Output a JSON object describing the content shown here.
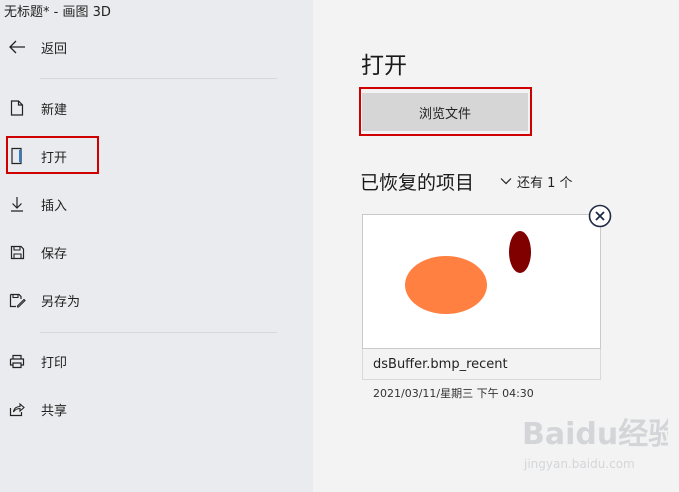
{
  "window": {
    "title": "无标题* - 画图 3D"
  },
  "sidebar": {
    "back_label": "返回",
    "items": [
      {
        "label": "新建",
        "icon": "new-file-icon"
      },
      {
        "label": "打开",
        "icon": "open-file-icon"
      },
      {
        "label": "插入",
        "icon": "insert-icon"
      },
      {
        "label": "保存",
        "icon": "save-icon"
      },
      {
        "label": "另存为",
        "icon": "save-as-icon"
      },
      {
        "label": "打印",
        "icon": "print-icon"
      },
      {
        "label": "共享",
        "icon": "share-icon"
      }
    ]
  },
  "main": {
    "heading": "打开",
    "browse_label": "浏览文件",
    "recovered_title": "已恢复的项目",
    "more_label": "还有 1 个",
    "recovered_items": [
      {
        "file_name": "dsBuffer.bmp_recent",
        "date": "2021/03/11/星期三 下午 04:30"
      }
    ]
  },
  "colors": {
    "sidebar_bg": "#e9ebee",
    "main_bg": "#f3f3f3",
    "highlight": "#d00000",
    "thumb_ellipse_orange": "#ff8040",
    "thumb_ellipse_dark_red": "#800000"
  },
  "watermark": {
    "brand": "Baidu经验",
    "url": "jingyan.baidu.com"
  }
}
